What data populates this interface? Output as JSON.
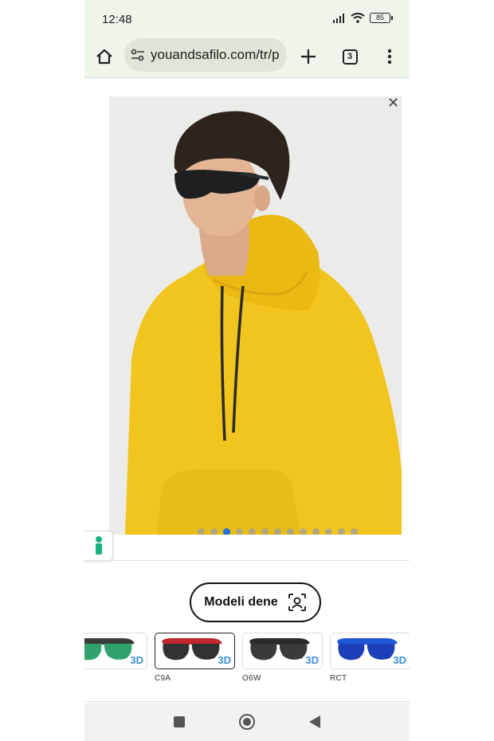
{
  "status": {
    "time": "12:48",
    "battery": "85"
  },
  "browser": {
    "url": "youandsafilo.com/tr/p",
    "tab_count": "3"
  },
  "gallery": {
    "dot_count": 13,
    "active_dot": 2
  },
  "tryon": {
    "label": "Modeli dene"
  },
  "variants": [
    {
      "code": "",
      "badge": "3D",
      "frame_color": "#3a3f3c",
      "lens_color": "#2fa36b"
    },
    {
      "code": "C9A",
      "badge": "3D",
      "frame_color": "#c0262a",
      "lens_color": "#2f3133",
      "selected": true
    },
    {
      "code": "O6W",
      "badge": "3D",
      "frame_color": "#2a2a2a",
      "lens_color": "#3a3a3a"
    },
    {
      "code": "RCT",
      "badge": "3D",
      "frame_color": "#1f57d6",
      "lens_color": "#1b3fb8"
    }
  ],
  "colors": {
    "hoodie": "#f2c51e",
    "background": "#ebebea",
    "accent": "#1e6fe0"
  }
}
